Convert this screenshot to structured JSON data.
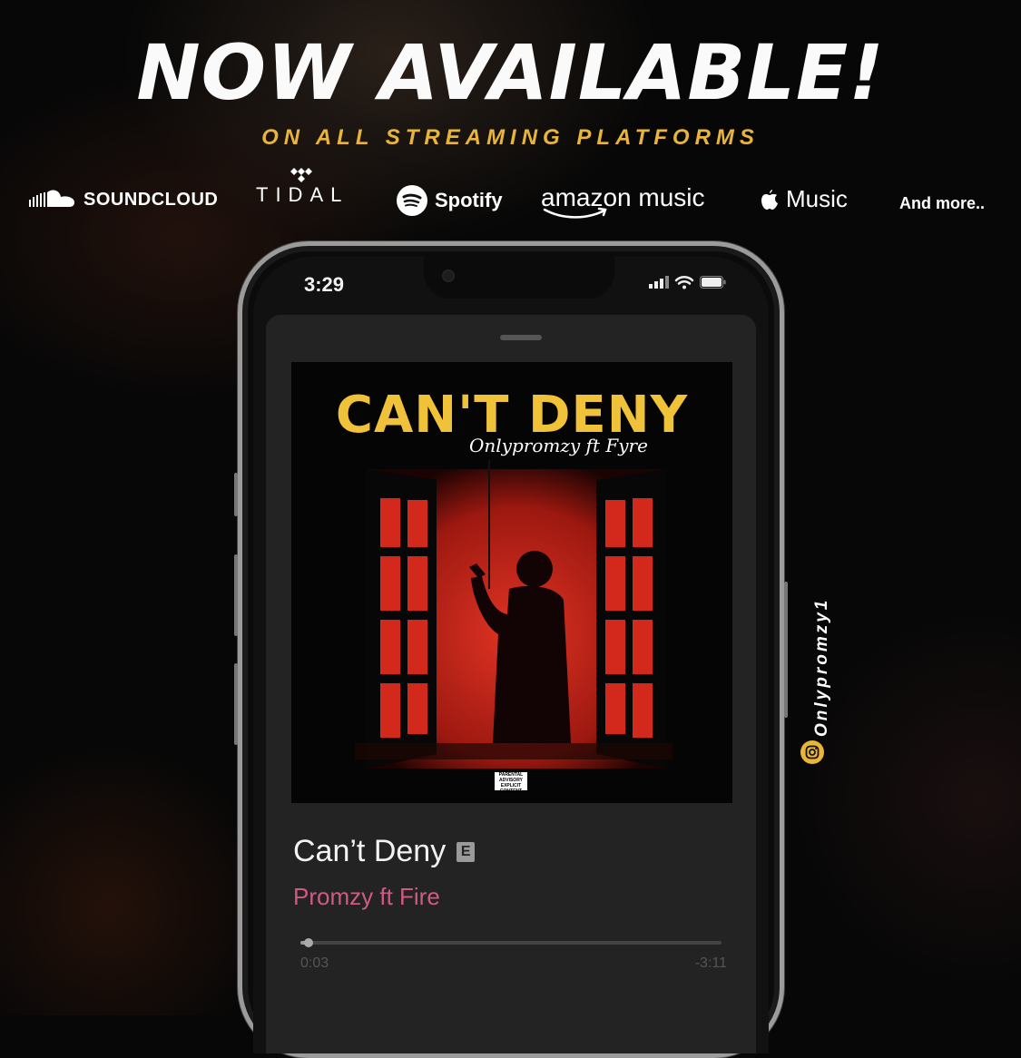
{
  "headline": "NOW AVAILABLE!",
  "subhead": "ON ALL STREAMING PLATFORMS",
  "platforms": {
    "soundcloud": {
      "label": "SOUNDCLOUD",
      "icon": "soundcloud-icon"
    },
    "tidal": {
      "label": "TIDAL",
      "icon": "tidal-icon"
    },
    "spotify": {
      "label": "Spotify",
      "icon": "spotify-icon"
    },
    "amazon": {
      "label": "amazon music",
      "icon": "amazon-smile-icon"
    },
    "apple": {
      "label": "Music",
      "icon": "apple-icon"
    },
    "more": {
      "label": "And more.."
    }
  },
  "phone": {
    "status_time": "3:29",
    "cover": {
      "title": "CAN'T DENY",
      "artist": "Onlypromzy ft Fyre",
      "advisory": "PARENTAL ADVISORY EXPLICIT CONTENT"
    },
    "track": {
      "title": "Can’t Deny",
      "explicit_badge": "E",
      "artist": "Promzy ft Fire",
      "elapsed": "0:03",
      "remaining": "-3:11",
      "progress": 0.016
    }
  },
  "social": {
    "handle": "Onlypromzy1",
    "icon": "instagram-icon"
  },
  "colors": {
    "accent": "#e8b53a",
    "artist_pink": "#d05a86",
    "art_red": "#c0281e"
  }
}
